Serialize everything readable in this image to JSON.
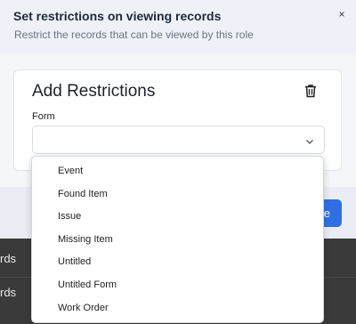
{
  "modal": {
    "title": "Set restrictions on viewing records",
    "subtitle": "Restrict the records that can be viewed by this role",
    "close_label": "×"
  },
  "card": {
    "title": "Add Restrictions",
    "form_label": "Form",
    "select_value": ""
  },
  "dropdown": {
    "options": [
      "Event",
      "Found Item",
      "Issue",
      "Missing Item",
      "Untitled",
      "Untitled Form",
      "Work Order"
    ]
  },
  "footer": {
    "primary_label_visible": "e"
  },
  "background": {
    "row_texts": [
      "rds",
      "rds"
    ]
  },
  "colors": {
    "accent": "#2f6fe5",
    "backdrop": "#3a3a3a",
    "modal_bg": "#f4f6f9"
  }
}
